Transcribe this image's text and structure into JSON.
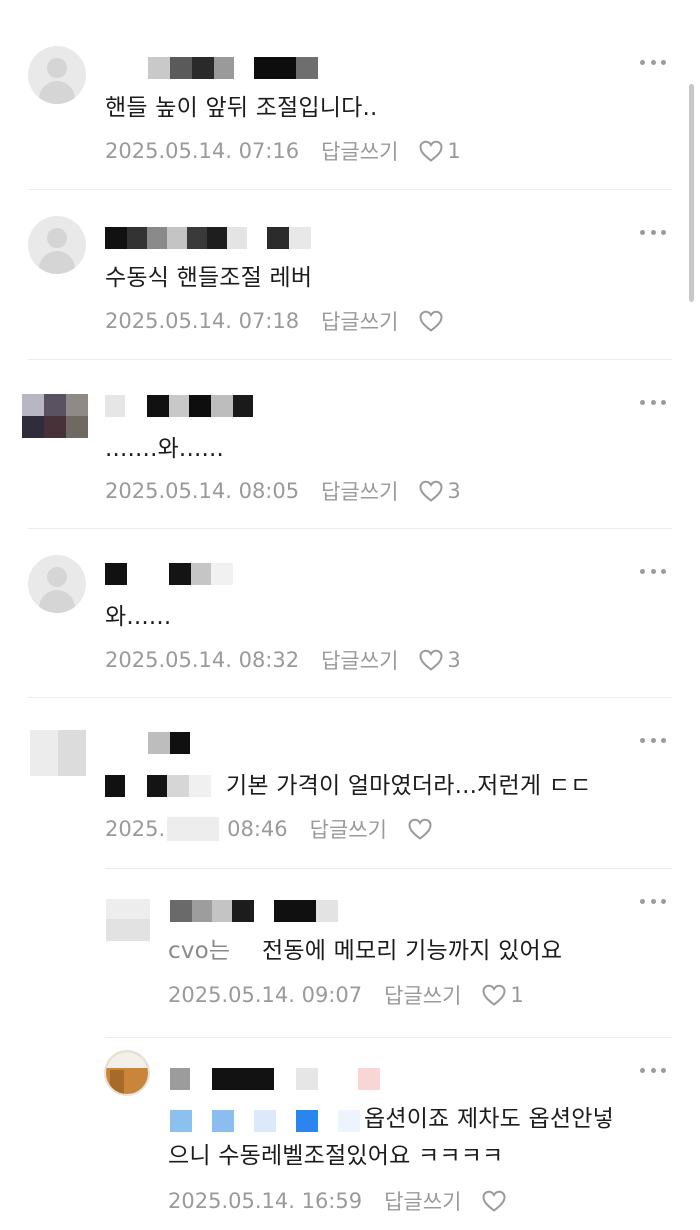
{
  "comments": [
    {
      "text": "핸들 높이 앞뒤 조절입니다..",
      "date": "2025.05.14. 07:16",
      "reply_label": "답글쓰기",
      "likes": "1"
    },
    {
      "text": "수동식 핸들조절 레버",
      "date": "2025.05.14. 07:18",
      "reply_label": "답글쓰기",
      "likes": ""
    },
    {
      "text": ".......와......",
      "date": "2025.05.14. 08:05",
      "reply_label": "답글쓰기",
      "likes": "3"
    },
    {
      "text": "와......",
      "date": "2025.05.14. 08:32",
      "reply_label": "답글쓰기",
      "likes": "3"
    },
    {
      "text": "기본 가격이 얼마였더라...저런게 ㄷㄷ",
      "date_prefix": "2025.",
      "date_suffix": "08:46",
      "reply_label": "답글쓰기",
      "likes": ""
    }
  ],
  "replies": [
    {
      "text_visible": "전동에 메모리 기능까지 있어요",
      "text_partial": "cvo는",
      "date": "2025.05.14. 09:07",
      "reply_label": "답글쓰기",
      "likes": "1"
    },
    {
      "text_line1": "옵션이죠 제차도 옵션안넣",
      "text_line2": "으니 수동레벨조절있어요 ㅋㅋㅋㅋ",
      "date": "2025.05.14. 16:59",
      "reply_label": "답글쓰기",
      "likes": ""
    }
  ],
  "colors": {
    "text": "#1c1c1c",
    "meta": "#9a9a9a",
    "divider": "#ececec",
    "heart": "#9a9a9a"
  },
  "icons": {
    "more": "more-dots-icon",
    "like": "heart-outline-icon",
    "avatar": "default-avatar-icon"
  }
}
